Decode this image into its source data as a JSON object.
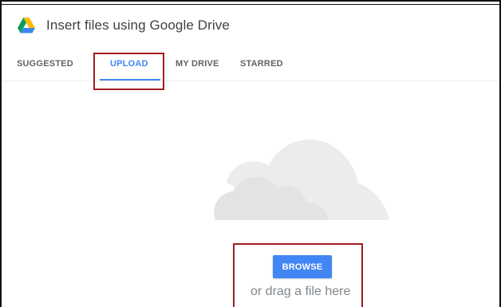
{
  "dialog": {
    "title": "Insert files using Google Drive",
    "logo_icon": "google-drive-icon"
  },
  "tabs": [
    {
      "label": "SUGGESTED",
      "active": false
    },
    {
      "label": "UPLOAD",
      "active": true
    },
    {
      "label": "MY DRIVE",
      "active": false
    },
    {
      "label": "STARRED",
      "active": false
    }
  ],
  "upload": {
    "illustration_icon": "cloud-icon",
    "browse_label": "BROWSE",
    "drag_hint": "or drag a file here"
  },
  "colors": {
    "accent": "#4285f4",
    "highlight": "#a31c22",
    "cloud": "#e8e8e8",
    "text": "#3c4043",
    "muted": "#80868b"
  }
}
